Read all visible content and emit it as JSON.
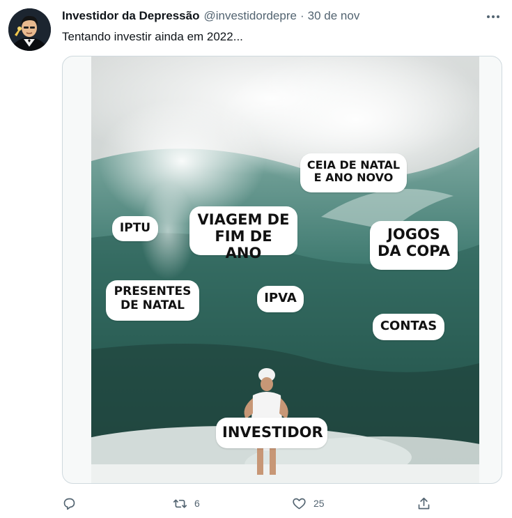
{
  "tweet": {
    "author_name": "Investidor da Depressão",
    "author_handle": "@investidordepre",
    "separator": "·",
    "timestamp": "30 de nov",
    "text": "Tentando investir ainda em 2022..."
  },
  "icons": {
    "more": "more-horizontal-icon",
    "reply": "reply-icon",
    "retweet": "retweet-icon",
    "like": "heart-icon",
    "share": "share-icon"
  },
  "meme": {
    "labels": {
      "ceia": "CEIA DE NATAL\nE ANO NOVO",
      "iptu": "IPTU",
      "viagem": "VIAGEM DE\nFIM DE ANO",
      "jogos": "JOGOS\nDA COPA",
      "presentes": "PRESENTES\nDE NATAL",
      "ipva": "IPVA",
      "contas": "CONTAS",
      "investidor": "INVESTIDOR"
    }
  },
  "actions": {
    "retweet_count": "6",
    "like_count": "25"
  },
  "colors": {
    "text_primary": "#0f1419",
    "text_secondary": "#536471",
    "border": "#cfd9de",
    "wave_dark": "#1f4a43",
    "wave_light": "#5e8f86"
  }
}
